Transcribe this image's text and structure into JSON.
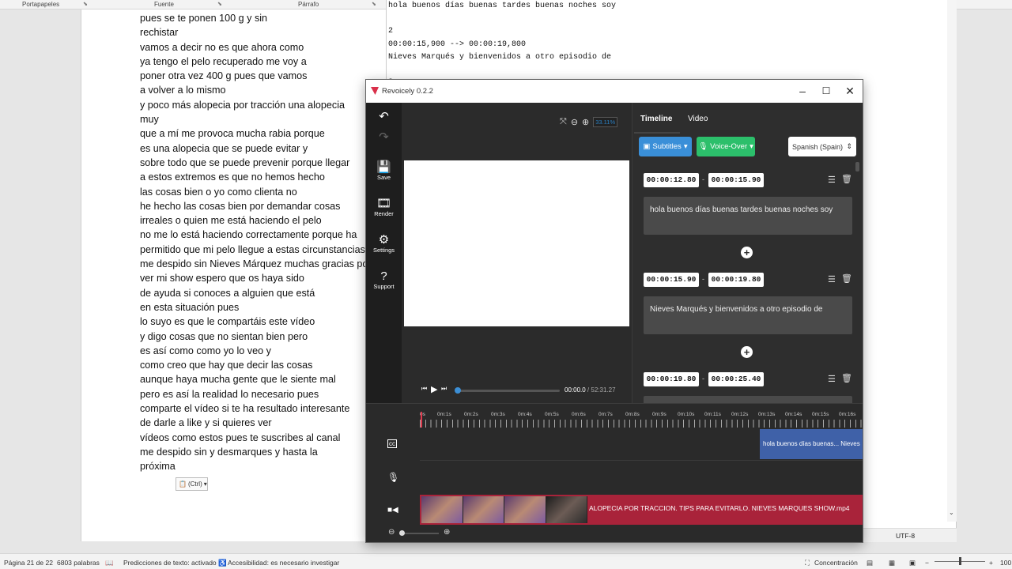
{
  "word": {
    "ribbon": {
      "clipboard": "Portapapeles",
      "font": "Fuente",
      "paragraph": "Párrafo"
    },
    "lines": [
      "pues se te ponen 100 g y sin",
      "rechistar",
      "vamos a decir no es que ahora como",
      "ya tengo el pelo recuperado me voy a",
      "poner otra vez 400 g pues que vamos",
      "a volver a lo mismo",
      "y poco más alopecia por tracción una alopecia",
      "muy",
      "que a mí me provoca mucha rabia porque",
      "es una alopecia que se puede evitar y",
      "sobre todo que se puede prevenir porque llegar",
      "a estos extremos es que no hemos hecho",
      "las cosas bien o yo como clienta no",
      "he hecho las cosas bien por demandar cosas",
      "irreales o quien me está haciendo el pelo",
      "no me lo está haciendo correctamente porque ha",
      "permitido que mi pelo llegue a estas circunstancias",
      "me despido sin Nieves Márquez muchas gracias por",
      "ver mi show espero que os haya sido",
      "de ayuda si conoces a alguien que está",
      "en esta situación pues",
      "lo suyo es que le compartáis este vídeo",
      "y digo cosas que no sientan bien pero",
      "es así como como yo lo veo y",
      "como creo que hay que decir las cosas",
      "aunque haya mucha gente que le siente mal",
      "pero es así la realidad lo necesario pues",
      "comparte el vídeo si te ha resultado interesante",
      "de darle a like y si quieres ver",
      "vídeos como estos pues te suscribes al canal",
      "me despido sin y desmarques y hasta la",
      "próxima"
    ],
    "paste_label": "(Ctrl)",
    "status": {
      "page": "Página 21 de 22",
      "words": "6803 palabras",
      "predictions": "Predicciones de texto: activado",
      "accessibility": "Accesibilidad: es necesario investigar",
      "focus": "Concentración",
      "zoom": "100"
    }
  },
  "notepad": {
    "text": "hola buenos días buenas tardes buenas noches soy\n\n2\n00:00:15,900 --> 00:00:19,800\nNieves Marqués y bienvenidos a otro episodio de\n\n3",
    "encoding": "UTF-8"
  },
  "revoicely": {
    "title": "Revoicely 0.2.2",
    "sidebar": {
      "save": "Save",
      "render": "Render",
      "settings": "Settings",
      "support": "Support"
    },
    "zoom_pct": "33.11%",
    "time_current": "00:00.0",
    "time_total": " / 52:31.27",
    "tabs": {
      "timeline": "Timeline",
      "video": "Video"
    },
    "subtitles_btn": "Subtitles",
    "voiceover_btn": "Voice-Over",
    "language": "Spanish (Spain)",
    "subs": [
      {
        "start": "00:00:12.80",
        "end": "00:00:15.90",
        "text": "hola buenos días buenas tardes buenas noches soy"
      },
      {
        "start": "00:00:15.90",
        "end": "00:00:19.80",
        "text": "Nieves Marqués y bienvenidos a otro episodio de"
      },
      {
        "start": "00:00:19.80",
        "end": "00:00:25.40",
        "text": ""
      }
    ],
    "ruler": [
      "0s",
      "0m:1s",
      "0m:2s",
      "0m:3s",
      "0m:4s",
      "0m:5s",
      "0m:6s",
      "0m:7s",
      "0m:8s",
      "0m:9s",
      "0m:10s",
      "0m:11s",
      "0m:12s",
      "0m:13s",
      "0m:14s",
      "0m:15s",
      "0m:16s"
    ],
    "sub_clip": "hola buenos días buenas...   Nieves",
    "video_file": "ALOPECIA POR TRACCION. TIPS PARA EVITARLO. NIEVES MARQUES SHOW.mp4"
  }
}
